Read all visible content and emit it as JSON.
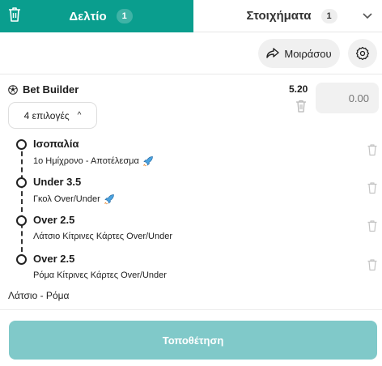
{
  "tabs": {
    "active": {
      "label": "Δελτίο",
      "count": "1"
    },
    "inactive": {
      "label": "Στοιχήματα",
      "count": "1"
    }
  },
  "actions": {
    "share_label": "Μοιράσου"
  },
  "bet_builder": {
    "title": "Bet Builder",
    "odds": "5.20",
    "stake_placeholder": "0.00",
    "selections_label": "4 επιλογές",
    "legs": [
      {
        "title": "Ισοπαλία",
        "subtitle": "1ο Ημίχρονο - Αποτέλεσμα",
        "boost": true
      },
      {
        "title": "Under 3.5",
        "subtitle": "Γκολ Over/Under",
        "boost": true
      },
      {
        "title": "Over 2.5",
        "subtitle": "Λάτσιο Κίτρινες Κάρτες Over/Under",
        "boost": false
      },
      {
        "title": "Over 2.5",
        "subtitle": "Ρόμα Κίτρινες Κάρτες Over/Under",
        "boost": false
      }
    ],
    "match": "Λάτσιο - Ρόμα"
  },
  "footer": {
    "place_label": "Τοποθέτηση"
  },
  "colors": {
    "accent": "#0a9e8e",
    "place_button": "#80c9c9"
  },
  "icons": [
    "trash-icon",
    "chevron-down-icon",
    "share-icon",
    "gear-icon",
    "soccer-ball-icon",
    "rocket-icon"
  ]
}
